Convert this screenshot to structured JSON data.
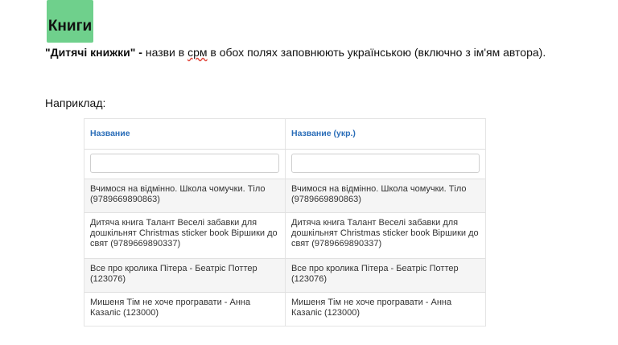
{
  "badge": {
    "label": "Книги"
  },
  "paragraph": {
    "bold_title": "\"Дитячі книжки\" -",
    "text_before": " назви в ",
    "underlined_word": "срм",
    "text_after": " в обох полях заповнюють українською (включно з ім'ям автора)."
  },
  "example_label": "Наприклад:",
  "table": {
    "headers": [
      "Название",
      "Название (укр.)"
    ],
    "rows": [
      [
        "Вчимося на відмінно. Школа чомучки. Тіло (9789669890863)",
        "Вчимося на відмінно. Школа чомучки. Тіло (9789669890863)"
      ],
      [
        "Дитяча книга Талант Веселі забавки для дошкільнят Christmas sticker book Віршики до свят (9789669890337)",
        "Дитяча книга Талант Веселі забавки для дошкільнят Christmas sticker book Віршики до свят (9789669890337)"
      ],
      [
        "Все про кролика Пітера - Беатріс Поттер (123076)",
        "Все про кролика Пітера - Беатріс Поттер (123076)"
      ],
      [
        "Мишеня Тім не хоче програвати - Анна Казаліс (123000)",
        "Мишеня Тім не хоче програвати - Анна Казаліс (123000)"
      ]
    ]
  }
}
